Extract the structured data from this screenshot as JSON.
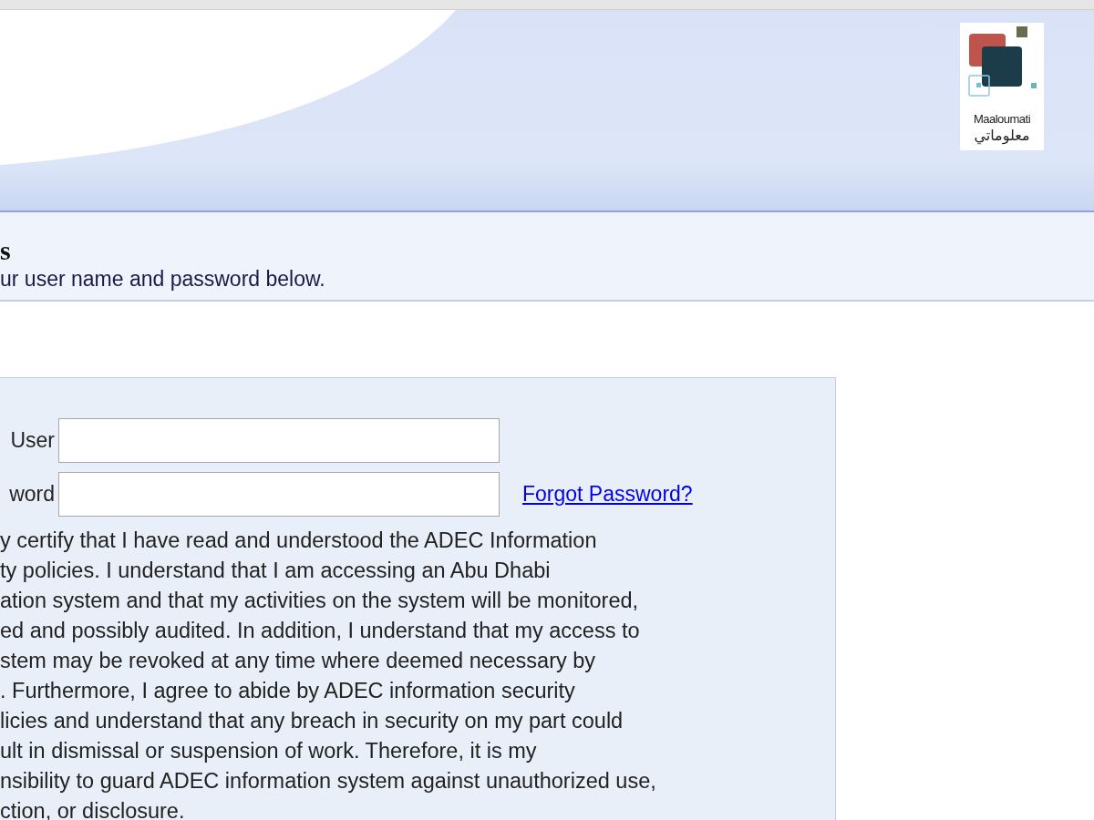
{
  "header": {
    "logo": {
      "latin": "Maaloumati",
      "arabic": "معلوماتي"
    }
  },
  "intro": {
    "title": "s",
    "subtitle": "ur user name and password below."
  },
  "login": {
    "fields": [
      {
        "label": "User"
      },
      {
        "label": "word"
      }
    ],
    "link": "Forgot Password?",
    "statement": [
      "y certify that I have read and understood the ADEC Information",
      "ty policies. I understand that I am accessing an Abu Dhabi",
      "ation system and that my activities on the system will be monitored,",
      "ed and possibly audited. In addition, I understand that my access to",
      "stem may be revoked at any time where deemed necessary by",
      ". Furthermore, I agree to abide by ADEC information security",
      "licies and understand that any breach in security on my part could",
      "ult in dismissal or suspension of work. Therefore, it is my",
      "nsibility to guard ADEC information system against unauthorized use,",
      "ction, or disclosure."
    ]
  }
}
